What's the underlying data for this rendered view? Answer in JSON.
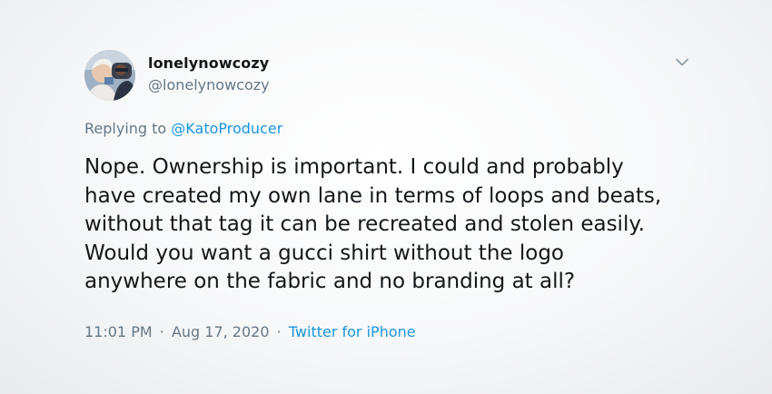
{
  "user": {
    "display_name": "lonelynowcozy",
    "handle": "@lonelynowcozy",
    "avatar_icon": "profile-photo"
  },
  "menu": {
    "icon": "chevron-down-icon"
  },
  "reply": {
    "prefix": "Replying to ",
    "mention": "@KatoProducer"
  },
  "tweet": {
    "lines": [
      "Nope. Ownership is important. I could and probably",
      "have created my own lane in terms of loops and beats,",
      "without that tag it can be recreated and stolen easily.",
      "Would you want a gucci shirt without the logo",
      "anywhere on the fabric and no branding at all?"
    ]
  },
  "meta": {
    "time": "11:01 PM",
    "separator": "·",
    "date": "Aug 17, 2020",
    "source": "Twitter for iPhone"
  },
  "colors": {
    "text": "#14171a",
    "secondary": "#657786",
    "link": "#1b95e0"
  }
}
